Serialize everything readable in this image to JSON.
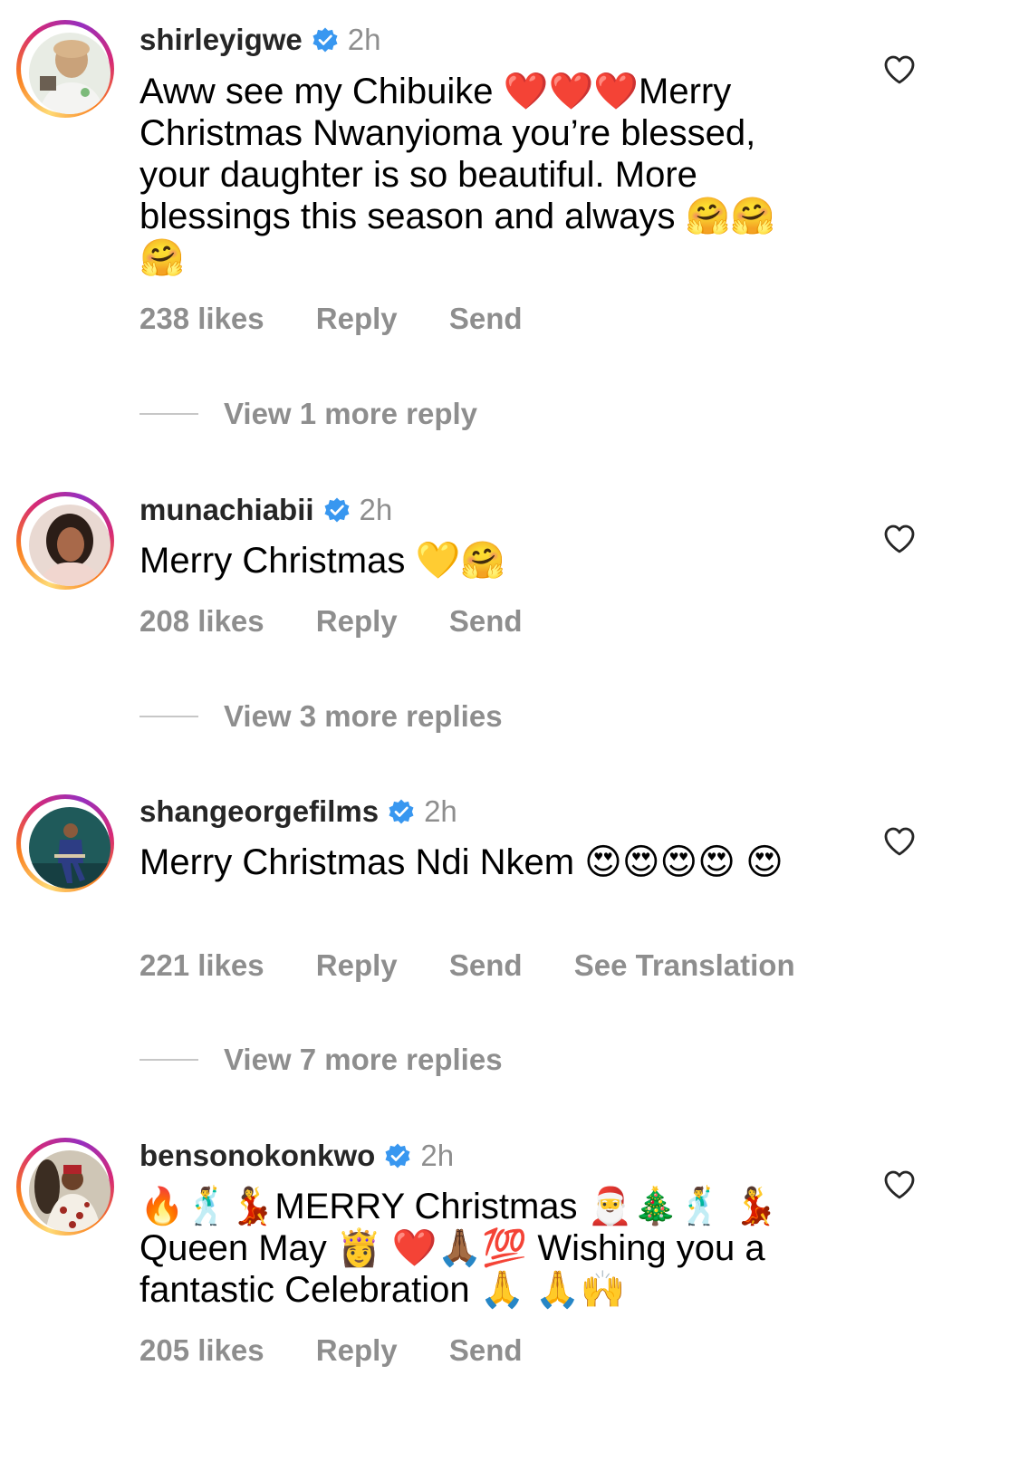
{
  "comments": [
    {
      "username": "shirleyigwe",
      "time": "2h",
      "text": "Aww see my Chibuike ❤️❤️❤️Merry Christmas Nwanyioma you’re blessed, your daughter is so beautiful. More blessings this season and always 🤗🤗 🤗",
      "likes": "238 likes",
      "reply": "Reply",
      "send": "Send",
      "view_replies": "View 1 more reply"
    },
    {
      "username": "munachiabii",
      "time": "2h",
      "text": "Merry Christmas 💛🤗",
      "likes": "208 likes",
      "reply": "Reply",
      "send": "Send",
      "view_replies": "View 3 more replies"
    },
    {
      "username": "shangeorgefilms",
      "time": "2h",
      "text": "Merry Christmas Ndi Nkem 😍😍😍😍 😍",
      "likes": "221 likes",
      "reply": "Reply",
      "send": "Send",
      "translation": "See Translation",
      "view_replies": "View 7 more replies"
    },
    {
      "username": "bensonokonkwo",
      "time": "2h",
      "text": "🔥🕺💃MERRY Christmas 🎅🎄🕺 💃 Queen May 👸 ❤️🙏🏾💯 Wishing you a fantastic Celebration 🙏 🙏🙌",
      "likes": "205 likes",
      "reply": "Reply",
      "send": "Send"
    }
  ],
  "colors": {
    "verified": "#3897f0",
    "secondary_text": "#8e8e8e",
    "primary_text": "#000000"
  },
  "icons": {
    "like": "heart-outline-icon",
    "verified": "verified-badge-icon"
  }
}
